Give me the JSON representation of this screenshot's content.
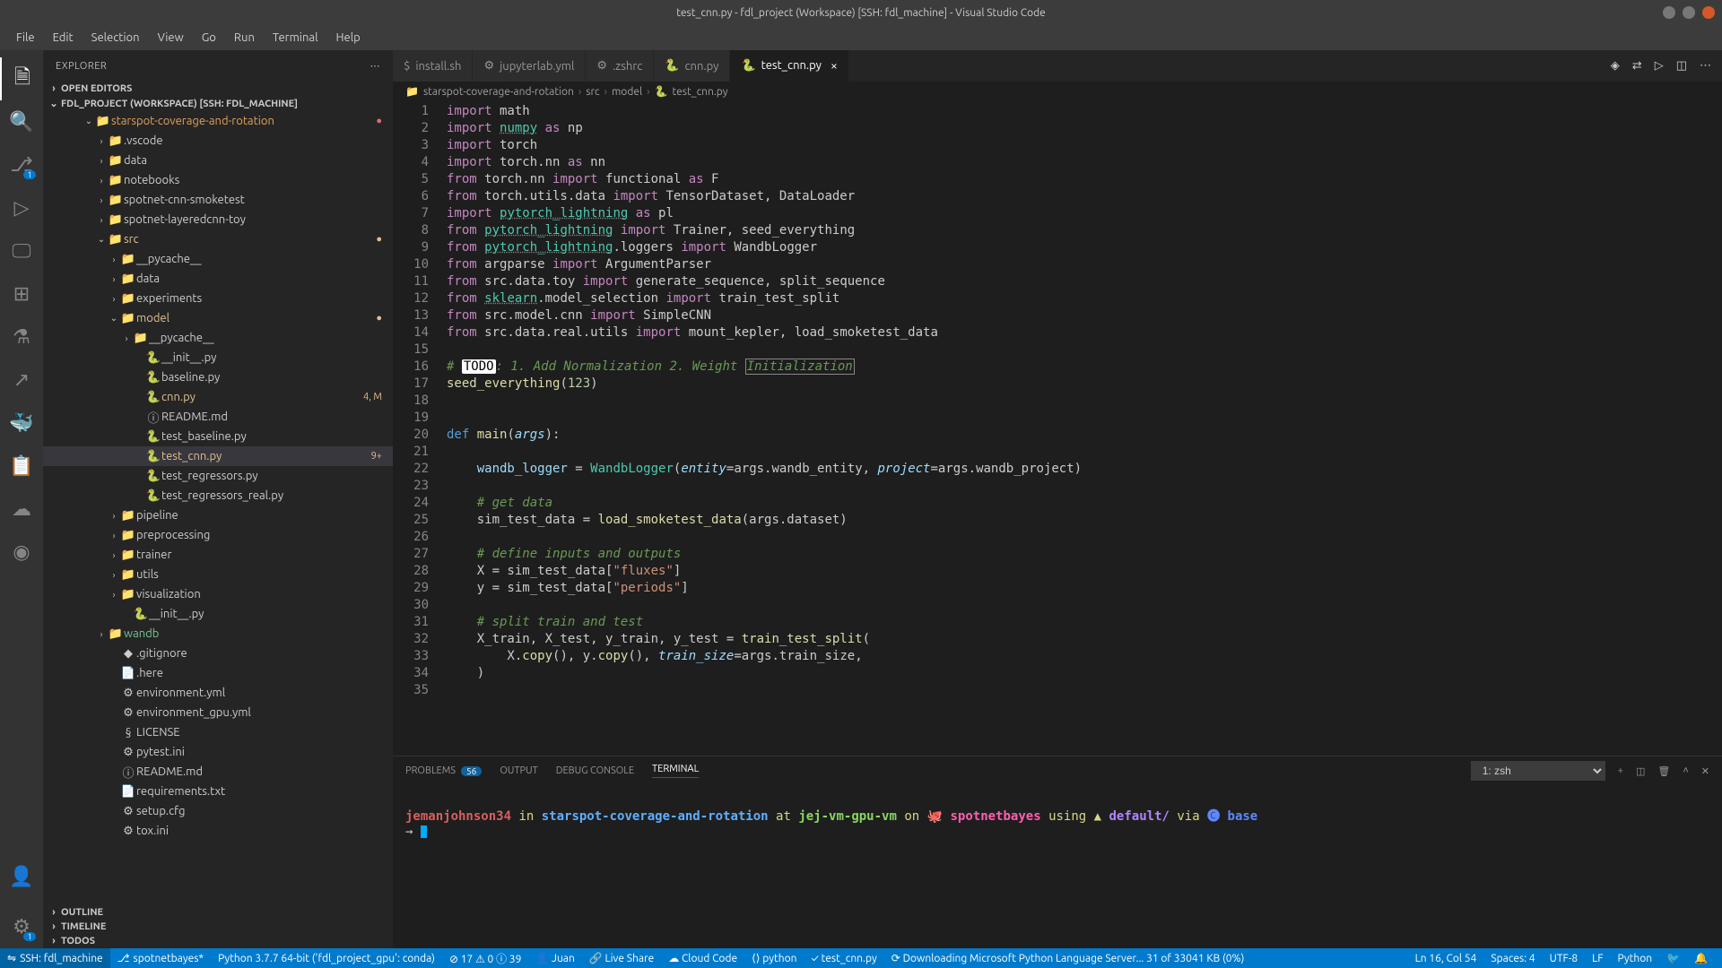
{
  "window": {
    "title": "test_cnn.py - fdl_project (Workspace) [SSH: fdl_machine] - Visual Studio Code"
  },
  "menu": [
    "File",
    "Edit",
    "Selection",
    "View",
    "Go",
    "Run",
    "Terminal",
    "Help"
  ],
  "sidebar": {
    "title": "EXPLORER",
    "sections": {
      "open_editors": "OPEN EDITORS",
      "workspace": "FDL_PROJECT (WORKSPACE) [SSH: FDL_MACHINE]",
      "outline": "OUTLINE",
      "timeline": "TIMELINE",
      "todos": "TODOS"
    },
    "root": "starspot-coverage-and-rotation",
    "tree": [
      {
        "pad": 58,
        "chev": "›",
        "icon": "📁",
        "label": ".vscode",
        "cls": "folder"
      },
      {
        "pad": 58,
        "chev": "›",
        "icon": "📁",
        "label": "data",
        "cls": "folder"
      },
      {
        "pad": 58,
        "chev": "›",
        "icon": "📁",
        "label": "notebooks",
        "cls": "folder"
      },
      {
        "pad": 58,
        "chev": "›",
        "icon": "📁",
        "label": "spotnet-cnn-smoketest",
        "cls": "folder"
      },
      {
        "pad": 58,
        "chev": "›",
        "icon": "📁",
        "label": "spotnet-layeredcnn-toy",
        "cls": "folder"
      },
      {
        "pad": 58,
        "chev": "⌄",
        "icon": "📁",
        "label": "src",
        "cls": "mod",
        "deco": "●"
      },
      {
        "pad": 72,
        "chev": "›",
        "icon": "📁",
        "label": "__pycache__",
        "cls": "folder"
      },
      {
        "pad": 72,
        "chev": "›",
        "icon": "📁",
        "label": "data",
        "cls": "folder"
      },
      {
        "pad": 72,
        "chev": "›",
        "icon": "📁",
        "label": "experiments",
        "cls": "folder"
      },
      {
        "pad": 72,
        "chev": "⌄",
        "icon": "📁",
        "label": "model",
        "cls": "mod",
        "deco": "●"
      },
      {
        "pad": 86,
        "chev": "›",
        "icon": "📁",
        "label": "__pycache__",
        "cls": "folder"
      },
      {
        "pad": 100,
        "chev": "",
        "icon": "🐍",
        "label": "__init__.py",
        "cls": ""
      },
      {
        "pad": 100,
        "chev": "",
        "icon": "🐍",
        "label": "baseline.py",
        "cls": ""
      },
      {
        "pad": 100,
        "chev": "",
        "icon": "🐍",
        "label": "cnn.py",
        "cls": "mod",
        "deco": "4, M"
      },
      {
        "pad": 100,
        "chev": "",
        "icon": "ⓘ",
        "label": "README.md",
        "cls": ""
      },
      {
        "pad": 100,
        "chev": "",
        "icon": "🐍",
        "label": "test_baseline.py",
        "cls": ""
      },
      {
        "pad": 100,
        "chev": "",
        "icon": "🐍",
        "label": "test_cnn.py",
        "cls": "mod active",
        "deco": "9+"
      },
      {
        "pad": 100,
        "chev": "",
        "icon": "🐍",
        "label": "test_regressors.py",
        "cls": ""
      },
      {
        "pad": 100,
        "chev": "",
        "icon": "🐍",
        "label": "test_regressors_real.py",
        "cls": ""
      },
      {
        "pad": 72,
        "chev": "›",
        "icon": "📁",
        "label": "pipeline",
        "cls": "folder"
      },
      {
        "pad": 72,
        "chev": "›",
        "icon": "📁",
        "label": "preprocessing",
        "cls": "folder"
      },
      {
        "pad": 72,
        "chev": "›",
        "icon": "📁",
        "label": "trainer",
        "cls": "folder"
      },
      {
        "pad": 72,
        "chev": "›",
        "icon": "📁",
        "label": "utils",
        "cls": "folder"
      },
      {
        "pad": 72,
        "chev": "›",
        "icon": "📁",
        "label": "visualization",
        "cls": "folder"
      },
      {
        "pad": 86,
        "chev": "",
        "icon": "🐍",
        "label": "__init__.py",
        "cls": ""
      },
      {
        "pad": 58,
        "chev": "›",
        "icon": "📁",
        "label": "wandb",
        "cls": "untracked"
      },
      {
        "pad": 72,
        "chev": "",
        "icon": "◆",
        "label": ".gitignore",
        "cls": ""
      },
      {
        "pad": 72,
        "chev": "",
        "icon": "📄",
        "label": ".here",
        "cls": ""
      },
      {
        "pad": 72,
        "chev": "",
        "icon": "⚙",
        "label": "environment.yml",
        "cls": ""
      },
      {
        "pad": 72,
        "chev": "",
        "icon": "⚙",
        "label": "environment_gpu.yml",
        "cls": ""
      },
      {
        "pad": 72,
        "chev": "",
        "icon": "§",
        "label": "LICENSE",
        "cls": ""
      },
      {
        "pad": 72,
        "chev": "",
        "icon": "⚙",
        "label": "pytest.ini",
        "cls": ""
      },
      {
        "pad": 72,
        "chev": "",
        "icon": "ⓘ",
        "label": "README.md",
        "cls": ""
      },
      {
        "pad": 72,
        "chev": "",
        "icon": "📄",
        "label": "requirements.txt",
        "cls": ""
      },
      {
        "pad": 72,
        "chev": "",
        "icon": "⚙",
        "label": "setup.cfg",
        "cls": ""
      },
      {
        "pad": 72,
        "chev": "",
        "icon": "⚙",
        "label": "tox.ini",
        "cls": ""
      }
    ]
  },
  "tabs": [
    {
      "icon": "$",
      "label": "install.sh",
      "active": false
    },
    {
      "icon": "⚙",
      "label": "jupyterlab.yml",
      "active": false
    },
    {
      "icon": "⚙",
      "label": ".zshrc",
      "active": false
    },
    {
      "icon": "🐍",
      "label": "cnn.py",
      "active": false
    },
    {
      "icon": "🐍",
      "label": "test_cnn.py",
      "active": true
    }
  ],
  "breadcrumb": [
    "starspot-coverage-and-rotation",
    "src",
    "model",
    "test_cnn.py"
  ],
  "code_lines": [
    {
      "n": 1,
      "html": "<span class='kw'>import</span> math"
    },
    {
      "n": 2,
      "html": "<span class='kw'>import</span> <span class='mod2'>numpy</span> <span class='kw'>as</span> np"
    },
    {
      "n": 3,
      "html": "<span class='kw'>import</span> torch"
    },
    {
      "n": 4,
      "html": "<span class='kw'>import</span> torch.nn <span class='kw'>as</span> nn"
    },
    {
      "n": 5,
      "html": "<span class='kw'>from</span> torch.nn <span class='kw'>import</span> functional <span class='kw'>as</span> F"
    },
    {
      "n": 6,
      "html": "<span class='kw'>from</span> torch.utils.data <span class='kw'>import</span> TensorDataset, DataLoader"
    },
    {
      "n": 7,
      "html": "<span class='kw'>import</span> <span class='mod2'>pytorch_lightning</span> <span class='kw'>as</span> pl"
    },
    {
      "n": 8,
      "html": "<span class='kw'>from</span> <span class='mod2'>pytorch_lightning</span> <span class='kw'>import</span> Trainer, seed_everything"
    },
    {
      "n": 9,
      "html": "<span class='kw'>from</span> <span class='mod2'>pytorch_lightning</span>.loggers <span class='kw'>import</span> WandbLogger"
    },
    {
      "n": 10,
      "html": "<span class='kw'>from</span> argparse <span class='kw'>import</span> ArgumentParser"
    },
    {
      "n": 11,
      "html": "<span class='kw'>from</span> src.data.toy <span class='kw'>import</span> generate_sequence, split_sequence"
    },
    {
      "n": 12,
      "html": "<span class='kw'>from</span> <span class='mod2'>sklearn</span>.model_selection <span class='kw'>import</span> train_test_split"
    },
    {
      "n": 13,
      "html": "<span class='kw'>from</span> src.model.cnn <span class='kw'>import</span> SimpleCNN"
    },
    {
      "n": 14,
      "html": "<span class='kw'>from</span> src.data.real.utils <span class='kw'>import</span> mount_kepler, load_smoketest_data"
    },
    {
      "n": 15,
      "html": ""
    },
    {
      "n": 16,
      "html": "<span class='com'># <span class='todo'>TODO</span>: 1. Add Normalization 2. Weight <span class='hlsel'>Initialization</span></span>"
    },
    {
      "n": 17,
      "html": "<span class='fn'>seed_everything</span>(<span class='num'>123</span>)"
    },
    {
      "n": 18,
      "html": ""
    },
    {
      "n": 19,
      "html": ""
    },
    {
      "n": 20,
      "html": "<span class='def'>def</span> <span class='fn'>main</span>(<span class='par'>args</span>):"
    },
    {
      "n": 21,
      "html": ""
    },
    {
      "n": 22,
      "html": "    <span class='var'>wandb_logger</span> = <span class='mod3'>WandbLogger</span>(<span class='par'>entity</span>=args.wandb_entity, <span class='par'>project</span>=args.wandb_project)"
    },
    {
      "n": 23,
      "html": ""
    },
    {
      "n": 24,
      "html": "    <span class='com'># get data</span>"
    },
    {
      "n": 25,
      "html": "    sim_test_data = <span class='fn'>load_smoketest_data</span>(args.dataset)"
    },
    {
      "n": 26,
      "html": ""
    },
    {
      "n": 27,
      "html": "    <span class='com'># define inputs and outputs</span>"
    },
    {
      "n": 28,
      "html": "    X = sim_test_data[<span class='str'>\"fluxes\"</span>]"
    },
    {
      "n": 29,
      "html": "    y = sim_test_data[<span class='str'>\"periods\"</span>]"
    },
    {
      "n": 30,
      "html": ""
    },
    {
      "n": 31,
      "html": "    <span class='com'># split train and test</span>"
    },
    {
      "n": 32,
      "html": "    X_train, X_test, y_train, y_test = <span class='fn'>train_test_split</span>("
    },
    {
      "n": 33,
      "html": "        X.<span class='fn'>copy</span>(), y.<span class='fn'>copy</span>(), <span class='par'>train_size</span>=args.train_size,"
    },
    {
      "n": 34,
      "html": "    )"
    },
    {
      "n": 35,
      "html": ""
    }
  ],
  "panel": {
    "tabs": {
      "problems": "PROBLEMS",
      "problems_count": "56",
      "output": "OUTPUT",
      "debug": "DEBUG CONSOLE",
      "terminal": "TERMINAL"
    },
    "terminal_select": "1: zsh",
    "prompt": {
      "user": "jemanjohnson34",
      "in": " in ",
      "path": "starspot-coverage-and-rotation",
      "at": " at ",
      "host": "jej-vm-gpu-vm",
      "on": " on 🐙 ",
      "branch": "spotnetbayes",
      "using": " using ▲ ",
      "env": "default/",
      "via": " via ",
      "base": "🅒 base"
    }
  },
  "status": {
    "remote": "SSH: fdl_machine",
    "branch": "spotnetbayes*",
    "python": "Python 3.7.7 64-bit ('fdl_project_gpu': conda)",
    "errors": "⊘ 17 ⚠ 0 ⓘ 39",
    "user": "👤 Juan",
    "liveshare": "🔗 Live Share",
    "cloud": "☁ Cloud Code",
    "lang": "⟨⟩ python",
    "tests": "✓ test_cnn.py",
    "download": "⟳ Downloading Microsoft Python Language Server... 31 of 33041 KB (0%)",
    "pos": "Ln 16, Col 54",
    "spaces": "Spaces: 4",
    "encoding": "UTF-8",
    "eol": "LF",
    "filetype": "Python",
    "tweet": "🐦",
    "bell": "🔔"
  }
}
